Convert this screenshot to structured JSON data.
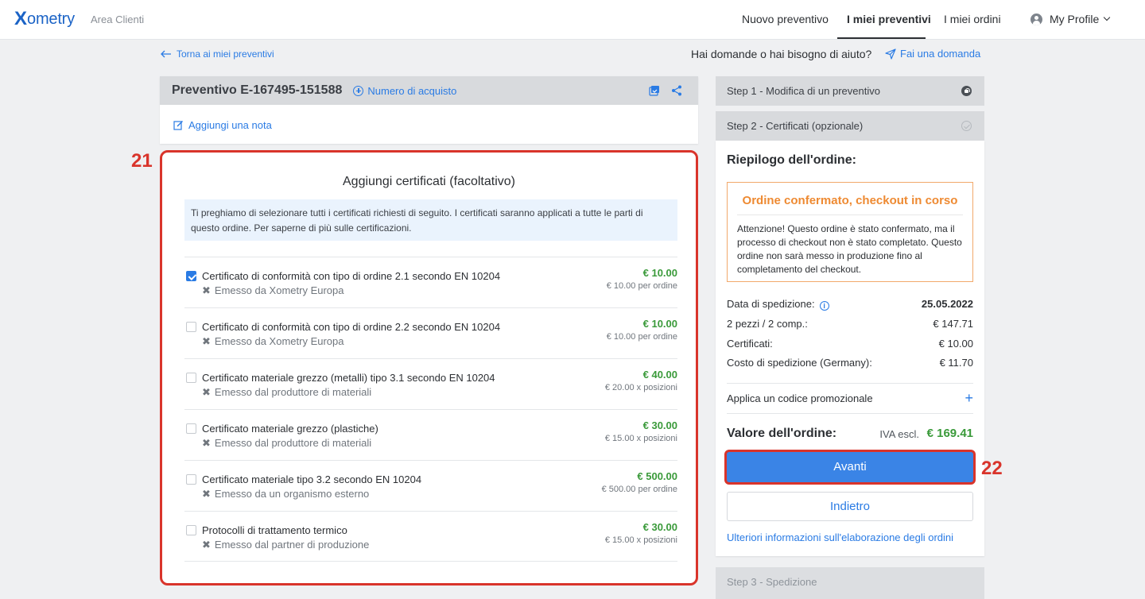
{
  "nav": {
    "logo_x": "X",
    "logo_rest": "ometry",
    "area": "Area Clienti",
    "links": [
      {
        "label": "Nuovo preventivo"
      },
      {
        "label": "I miei preventivi"
      },
      {
        "label": "I miei ordini"
      }
    ],
    "profile": "My Profile"
  },
  "back_link": "Torna ai miei preventivi",
  "help": {
    "question": "Hai domande o hai bisogno di aiuto?",
    "ask": "Fai una domanda"
  },
  "quote": {
    "title": "Preventivo E-167495-151588",
    "purchase_number": "Numero di acquisto",
    "add_note": "Aggiungi una nota"
  },
  "certificates": {
    "title": "Aggiungi certificati (facoltativo)",
    "info": "Ti preghiamo di selezionare tutti i certificati richiesti di seguito. I certificati saranno applicati a tutte le parti di questo ordine. Per saperne di più sulle certificazioni.",
    "items": [
      {
        "name": "Certificato di conformità con tipo di ordine 2.1 secondo EN 10204",
        "issuer": "Emesso da Xometry Europa",
        "price": "€ 10.00",
        "price_sub": "€ 10.00 per ordine",
        "checked": true
      },
      {
        "name": "Certificato di conformità con tipo di ordine 2.2 secondo EN 10204",
        "issuer": "Emesso da Xometry Europa",
        "price": "€ 10.00",
        "price_sub": "€ 10.00 per ordine",
        "checked": false
      },
      {
        "name": "Certificato materiale grezzo (metalli) tipo 3.1 secondo EN 10204",
        "issuer": "Emesso dal produttore di materiali",
        "price": "€ 40.00",
        "price_sub": "€ 20.00 x posizioni",
        "checked": false
      },
      {
        "name": "Certificato materiale grezzo (plastiche)",
        "issuer": "Emesso dal produttore di materiali",
        "price": "€ 30.00",
        "price_sub": "€ 15.00 x posizioni",
        "checked": false
      },
      {
        "name": "Certificato materiale tipo 3.2 secondo EN 10204",
        "issuer": "Emesso da un organismo esterno",
        "price": "€ 500.00",
        "price_sub": "€ 500.00 per ordine",
        "checked": false
      },
      {
        "name": "Protocolli di trattamento termico",
        "issuer": "Emesso dal partner di produzione",
        "price": "€ 30.00",
        "price_sub": "€ 15.00 x posizioni",
        "checked": false
      }
    ]
  },
  "markers": {
    "left": "21",
    "right": "22"
  },
  "steps": {
    "step1": "Step 1 - Modifica di un preventivo",
    "step2": "Step 2 - Certificati (opzionale)",
    "step3": "Step 3 - Spedizione"
  },
  "summary": {
    "title": "Riepilogo dell'ordine:",
    "warning_title": "Ordine confermato, checkout in corso",
    "warning_text": "Attenzione! Questo ordine è stato confermato, ma il processo di checkout non è stato completato. Questo ordine non sarà messo in produzione fino al completamento del checkout.",
    "rows": [
      {
        "label": "Data di spedizione:",
        "value": "25.05.2022"
      },
      {
        "label": "2 pezzi / 2 comp.:",
        "value": "€ 147.71"
      },
      {
        "label": "Certificati:",
        "value": "€ 10.00"
      },
      {
        "label": "Costo di spedizione (Germany):",
        "value": "€ 11.70"
      }
    ],
    "promo": "Applica un codice promozionale",
    "total_label": "Valore dell'ordine:",
    "total_iva": "IVA escl.",
    "total_value": "€ 169.41",
    "next": "Avanti",
    "back": "Indietro",
    "more": "Ulteriori informazioni sull'elaborazione degli ordini"
  },
  "colors": {
    "accent": "#2a7be4",
    "marker": "#d9342b",
    "price": "#3a9a3a",
    "warning": "#ee8a32"
  }
}
